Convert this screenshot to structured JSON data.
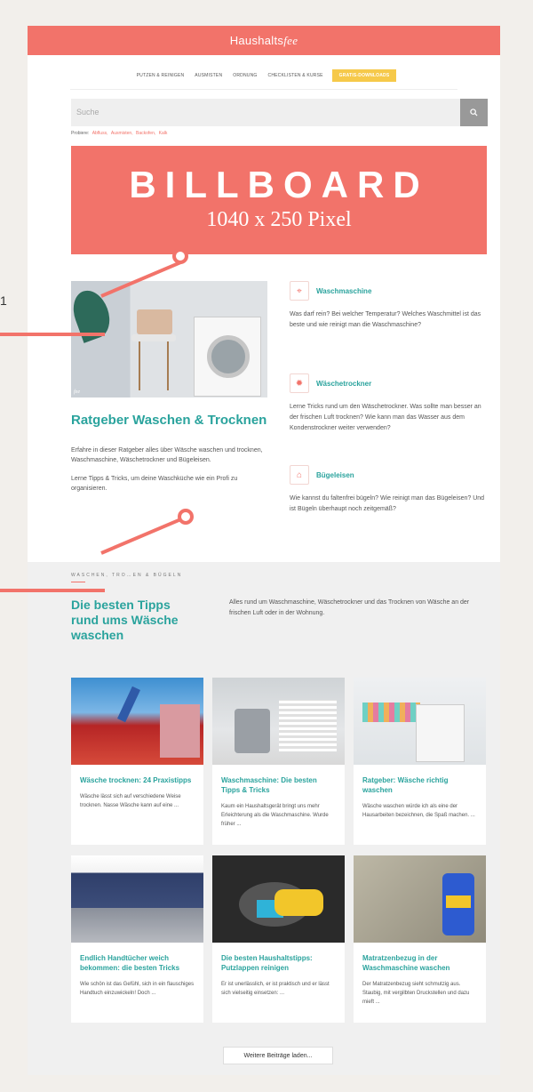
{
  "header": {
    "brand_main": "Haushalts",
    "brand_fee": "fee"
  },
  "nav": {
    "items": [
      "PUTZEN & REINIGEN",
      "AUSMISTEN",
      "ORDNUNG",
      "CHECKLISTEN & KURSE"
    ],
    "cta": "Gratis-Downloads"
  },
  "search": {
    "placeholder": "Suche",
    "button_icon": "search-icon"
  },
  "probiere": {
    "label": "Probiere:",
    "links": [
      "Abfluss,",
      "Ausmisten,",
      "Backofen,",
      "Kalk"
    ]
  },
  "billboard": {
    "line1": "BILLBOARD",
    "line2": "1040 x 250 Pixel"
  },
  "hero": {
    "title": "Ratgeber Waschen & Trocknen",
    "p1": "Erfahre in dieser Ratgeber alles über Wäsche waschen und trocknen, Waschmaschine, Wäschetrockner und Bügeleisen.",
    "p2": "Lerne Tipps & Tricks, um deine Waschküche wie ein Profi zu organisieren.",
    "watermark": "fee"
  },
  "categories": [
    {
      "title": "Waschmaschine",
      "icon": "laundry-basket-icon",
      "text": "Was darf rein? Bei welcher Temperatur? Welches Waschmittel ist das beste und wie reinigt man die Waschmaschine?"
    },
    {
      "title": "Wäschetrockner",
      "icon": "sun-icon",
      "text": "Lerne Tricks rund um den Wäschetrockner. Was sollte man besser an der frischen Luft trocknen? Wie kann man das Wasser aus dem Kondenstrockner weiter verwenden?"
    },
    {
      "title": "Bügeleisen",
      "icon": "shirt-icon",
      "text": "Wie kannst du faltenfrei bügeln? Wie reinigt man das Bügeleisen? Und ist Bügeln überhaupt noch zeitgemäß?"
    }
  ],
  "section": {
    "kicker": "WASCHEN, TRO…EN & BÜGELN",
    "title": "Die besten Tipps rund ums Wäsche waschen",
    "description": "Alles rund um Waschmaschine, Wäschetrockner und das Trocknen von Wäsche an der frischen Luft oder in der Wohnung."
  },
  "cards": [
    {
      "title": "Wäsche trocknen: 24 Praxistipps",
      "text": "Wäsche lässt sich auf verschiedene Weise trocknen. Nasse Wäsche kann auf eine ..."
    },
    {
      "title": "Waschmaschine: Die besten Tipps & Tricks",
      "text": "Kaum ein Haushaltsgerät bringt uns mehr Erleichterung als die Waschmaschine. Wurde früher ..."
    },
    {
      "title": "Ratgeber: Wäsche richtig waschen",
      "text": "Wäsche waschen würde ich als eine der Hausarbeiten bezeichnen, die Spaß machen. ..."
    },
    {
      "title": "Endlich Handtücher weich bekommen: die besten Tricks",
      "text": "Wie schön ist das Gefühl, sich in ein flauschiges Handtuch einzuwickeln! Doch ..."
    },
    {
      "title": "Die besten Haushaltstipps: Putzlappen reinigen",
      "text": "Er ist unerlässlich, er ist praktisch und er lässt sich vielseitig einsetzen: ..."
    },
    {
      "title": "Matratzenbezug in der Waschmaschine waschen",
      "text": "Der Matratzenbezug sieht schmutzig aus. Staubig, mit vergilbten Druckstellen und dazu mieft ..."
    }
  ],
  "more_button": "Weitere Beiträge laden...",
  "edge_label": "1",
  "colors": {
    "accent": "#f2736a",
    "teal": "#2aa39d",
    "cta": "#f6c94a"
  }
}
